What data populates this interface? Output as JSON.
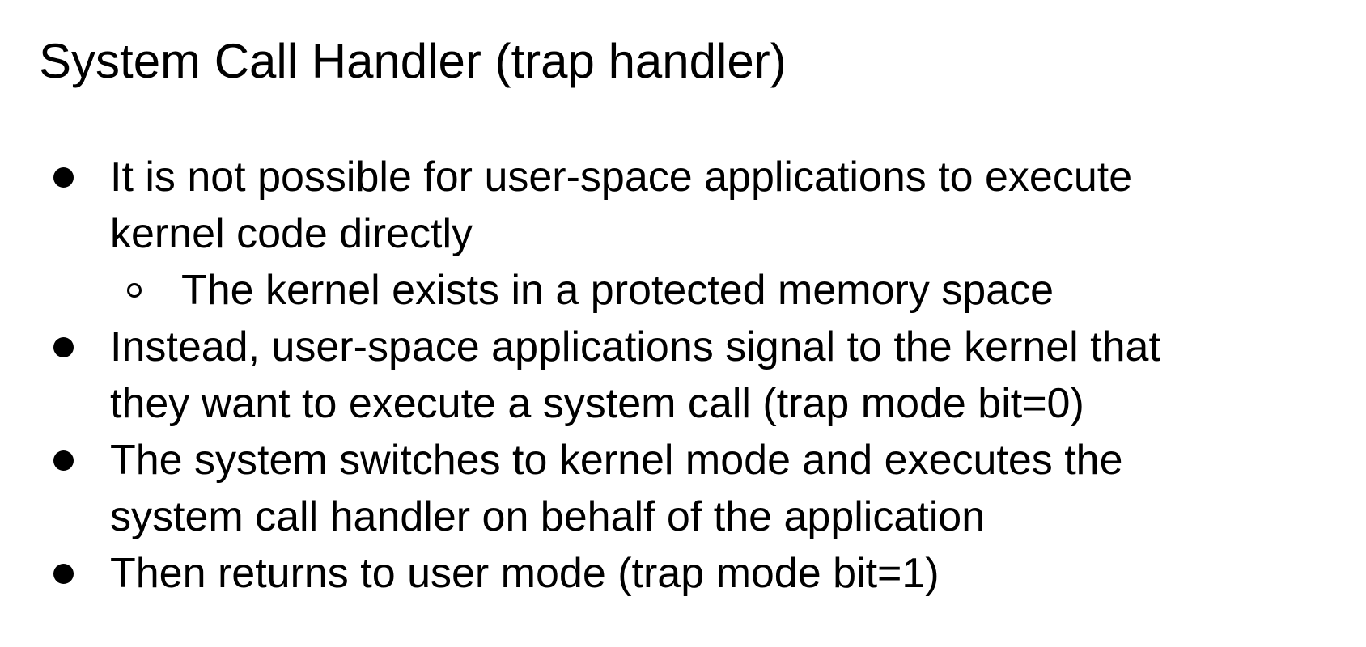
{
  "slide": {
    "title": "System Call Handler (trap handler)",
    "bullets": [
      {
        "lines": [
          "It is not possible for user-space applications to execute",
          "kernel code directly"
        ],
        "sub": [
          "The kernel exists in a protected memory space"
        ]
      },
      {
        "lines": [
          "Instead, user-space applications signal to the kernel that",
          "they want to execute a system call (trap mode bit=0)"
        ]
      },
      {
        "lines": [
          "The system switches to kernel mode and executes the",
          "system call handler on behalf of the application"
        ]
      },
      {
        "lines": [
          "Then returns to user mode (trap mode bit=1)"
        ]
      }
    ],
    "text_color": "#000000",
    "background_color": "#ffffff"
  }
}
